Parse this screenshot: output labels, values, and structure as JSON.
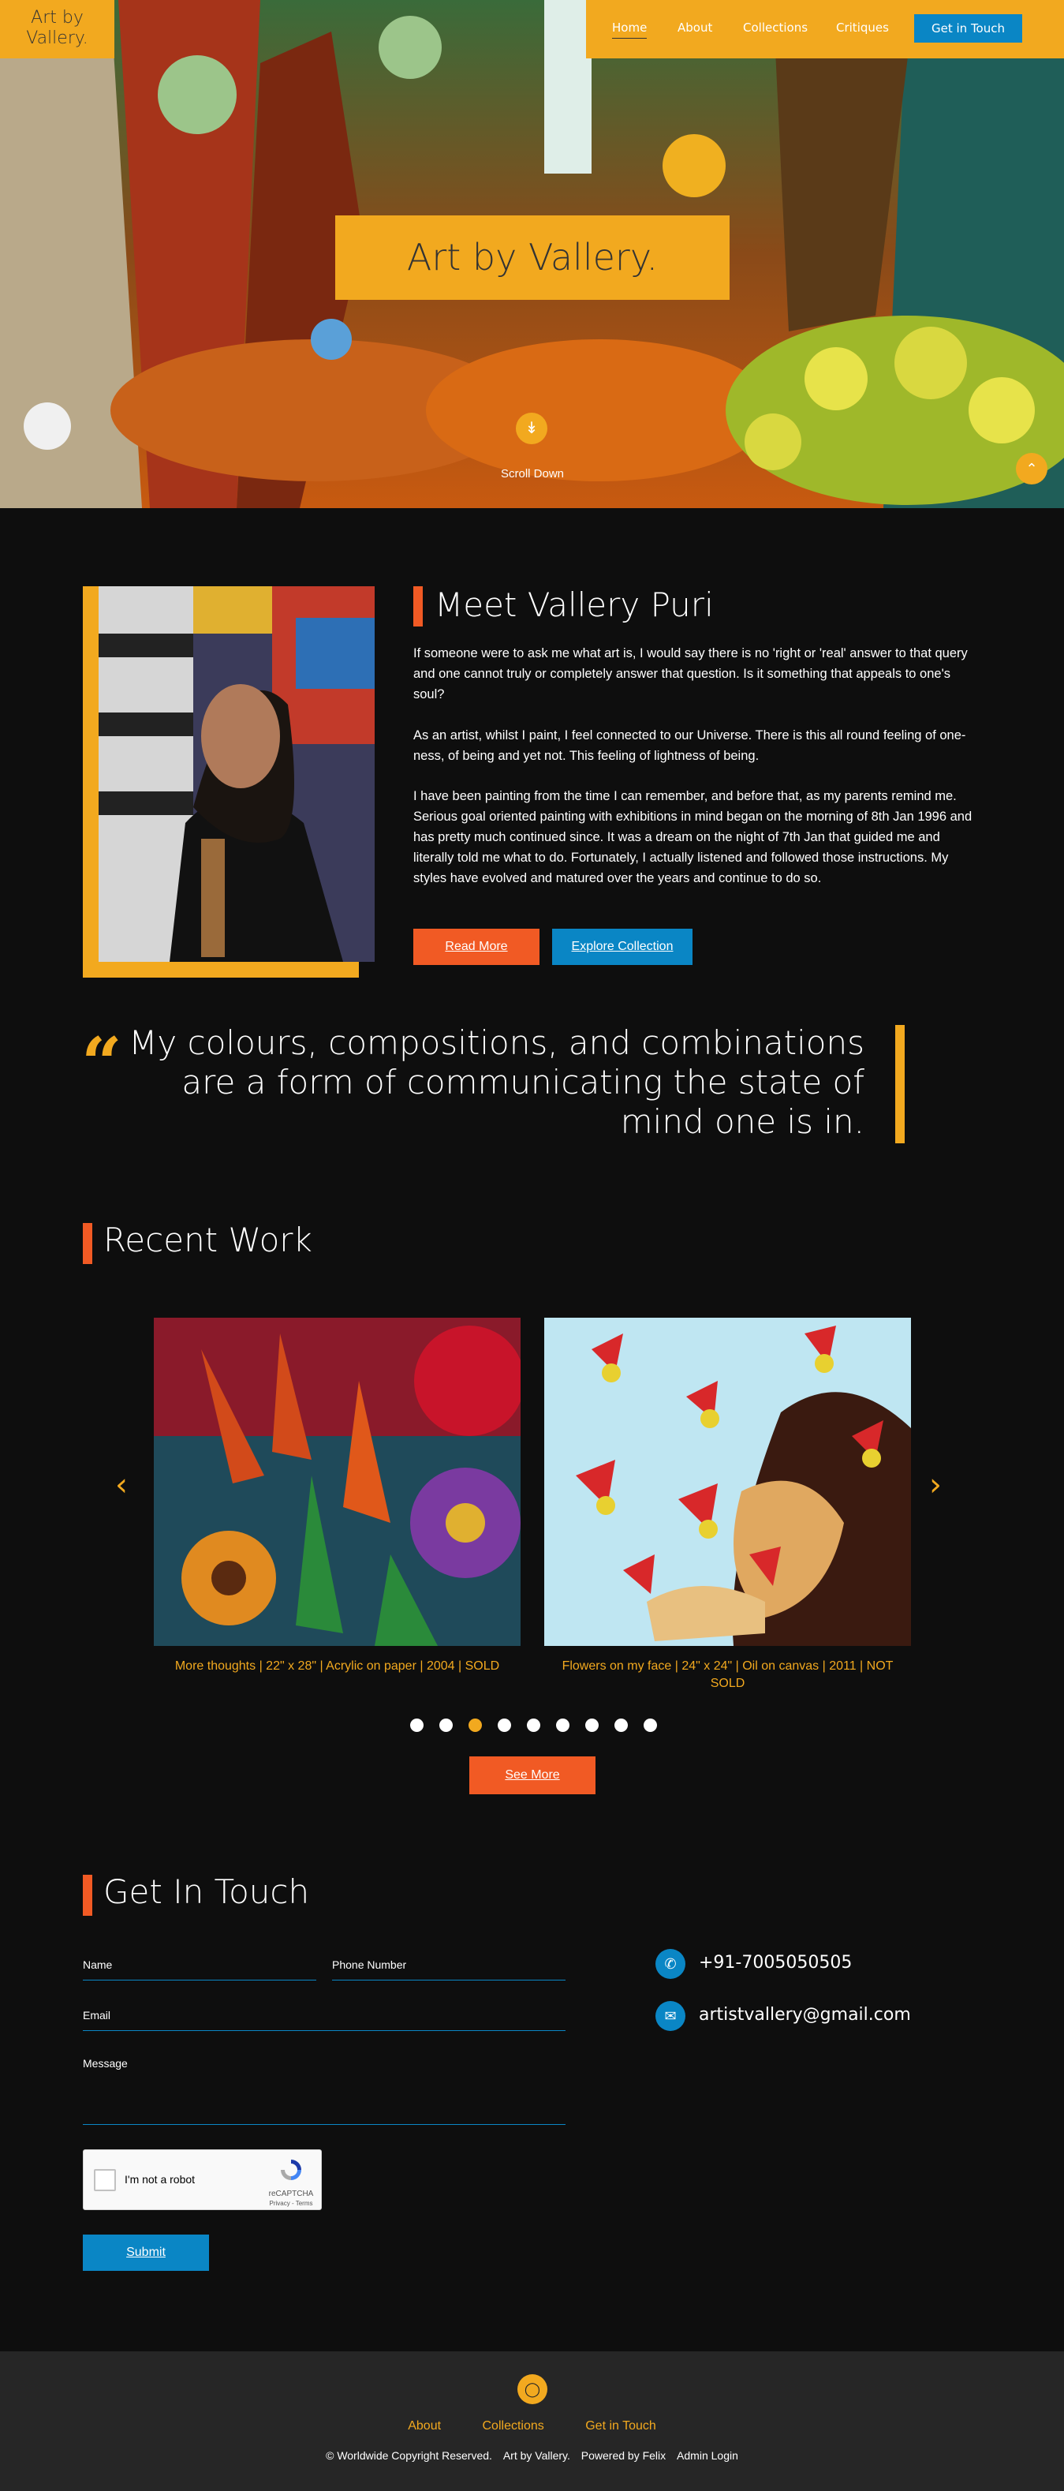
{
  "brand": {
    "logo_line1": "Art by",
    "logo_line2": "Vallery."
  },
  "nav": {
    "home": "Home",
    "about": "About",
    "collections": "Collections",
    "critiques": "Critiques",
    "cta": "Get in Touch"
  },
  "hero": {
    "title": "Art by Vallery.",
    "scroll_label": "Scroll Down"
  },
  "about": {
    "heading": "Meet Vallery Puri",
    "p1": "If someone were to ask me what art is, I would say there is no 'right or 'real' answer to that query and one cannot truly or completely answer that question. Is it something that appeals to one's soul?",
    "p2": "As an artist, whilst I paint, I feel connected to our Universe. There is this all round feeling of one-ness, of being and yet not. This feeling of lightness of being.",
    "p3": "I have been painting from the time I can remember, and before that, as my parents remind me. Serious goal oriented painting with exhibitions in mind began on the morning of 8th Jan 1996 and has pretty much continued since. It was a dream on the night of 7th Jan that guided me and literally told me what to do. Fortunately, I actually listened and followed those instructions. My styles have evolved and matured over the years and continue to do so.",
    "read_more": "Read More",
    "explore": "Explore Collection"
  },
  "quote": {
    "line1": "My colours, compositions, and combinations",
    "line2": "are a form of communicating the state of",
    "line3": "mind one is in."
  },
  "recent": {
    "heading": "Recent Work",
    "items": [
      {
        "caption": "More thoughts | 22\" x 28\" | Acrylic on paper | 2004 | SOLD"
      },
      {
        "caption": "Flowers on my face | 24\" x 24\" | Oil on canvas | 2011 | NOT SOLD"
      }
    ],
    "dots_total": 9,
    "active_dot": 3,
    "see_more": "See More"
  },
  "contact": {
    "heading": "Get In Touch",
    "name_label": "Name",
    "phone_label": "Phone Number",
    "email_label": "Email",
    "message_label": "Message",
    "recaptcha_text": "I'm not a robot",
    "recaptcha_brand": "reCAPTCHA",
    "recaptcha_links": "Privacy - Terms",
    "submit": "Submit",
    "phone": "+91-7005050505",
    "email": "artistvallery@gmail.com"
  },
  "footer": {
    "links": {
      "about": "About",
      "collections": "Collections",
      "contact": "Get in Touch"
    },
    "copyright": "© Worldwide Copyright Reserved.",
    "brand": "Art by Vallery.",
    "powered": "Powered by Felix",
    "admin": "Admin Login"
  },
  "colors": {
    "accent": "#f2a91f",
    "orange": "#f15a24",
    "blue": "#0a86c5",
    "bg": "#0e0e0e"
  }
}
